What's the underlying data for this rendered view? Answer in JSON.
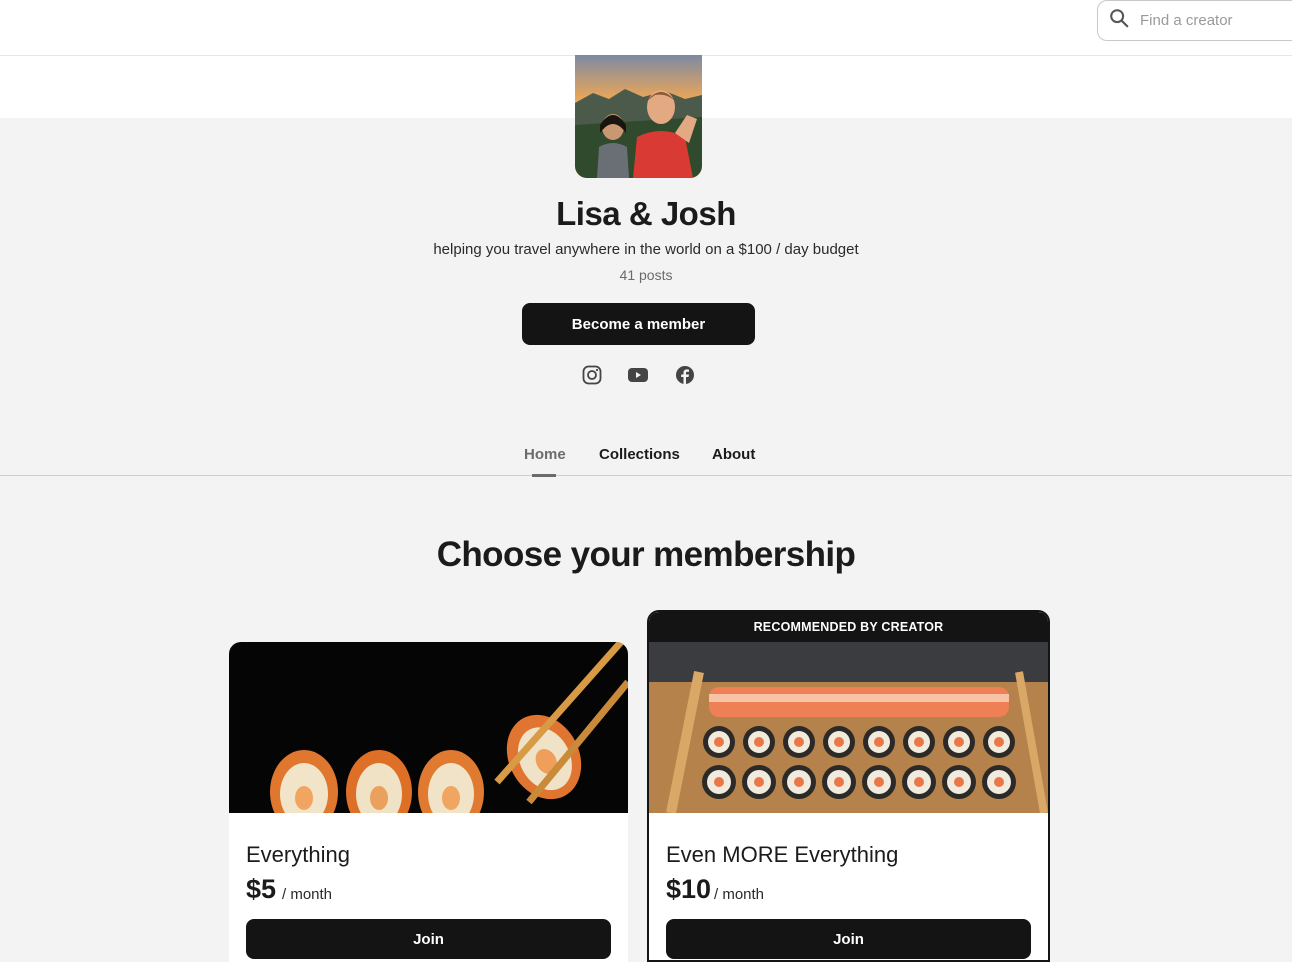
{
  "search": {
    "placeholder": "Find a creator"
  },
  "creator": {
    "name": "Lisa & Josh",
    "tagline": "helping you travel anywhere in the world on a $100 / day budget",
    "post_count": "41 posts",
    "cta_label": "Become a member",
    "socials": [
      "instagram-icon",
      "youtube-icon",
      "facebook-icon"
    ]
  },
  "tabs": [
    {
      "label": "Home",
      "active": true
    },
    {
      "label": "Collections",
      "active": false
    },
    {
      "label": "About",
      "active": false
    }
  ],
  "membership": {
    "title": "Choose your membership",
    "tiers": [
      {
        "name": "Everything",
        "price": "$5",
        "period": "/ month",
        "join_label": "Join",
        "recommended": false
      },
      {
        "name": "Even MORE Everything",
        "price": "$10",
        "period": "/ month",
        "join_label": "Join",
        "recommended": true,
        "banner": "RECOMMENDED BY CREATOR"
      }
    ]
  },
  "colors": {
    "primary": "#141414",
    "page_bg": "#f3f3f3"
  }
}
